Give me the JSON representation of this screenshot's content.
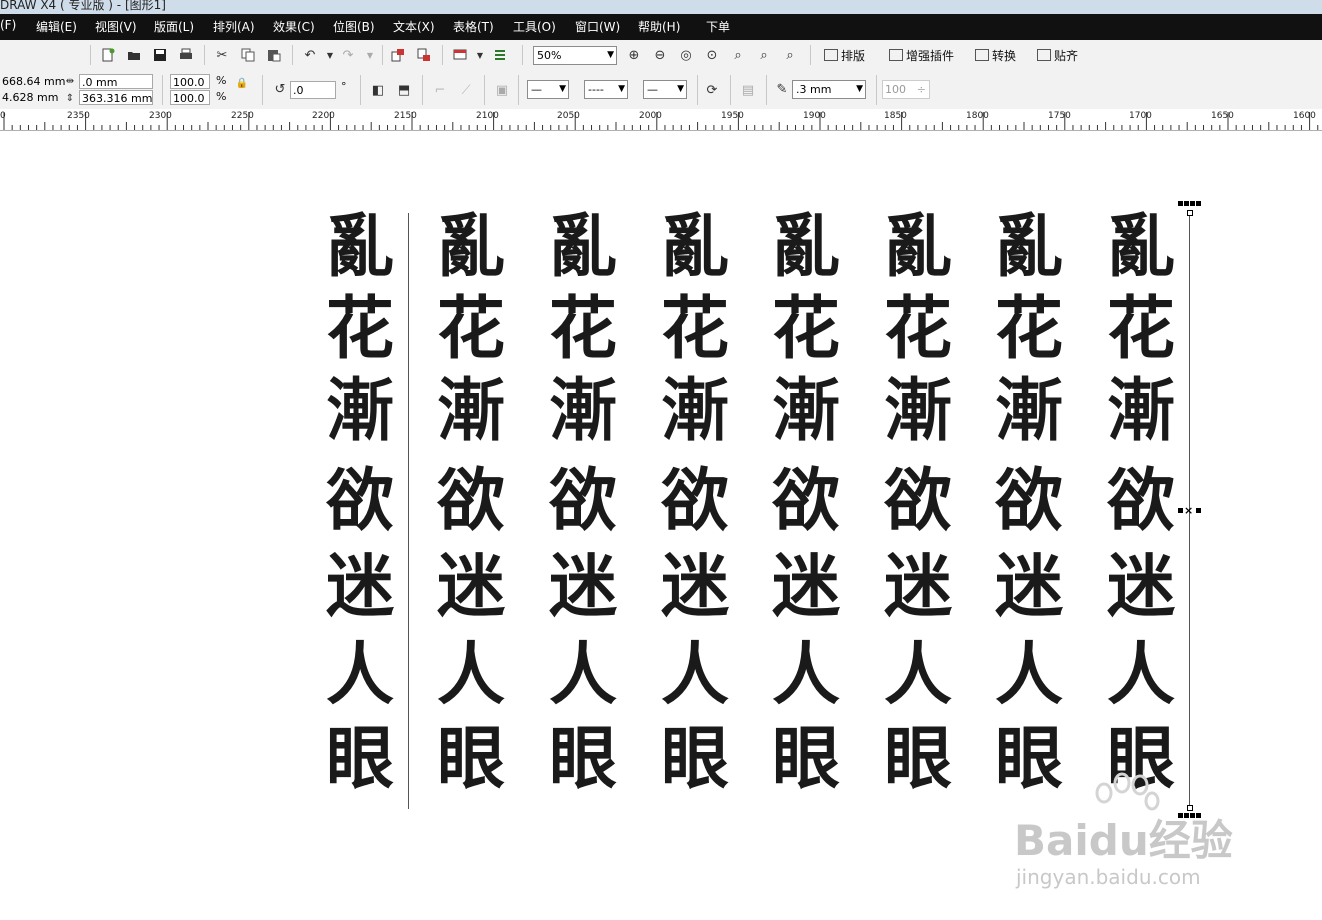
{
  "window": {
    "title": "DRAW X4 ( 专业版 ) - [图形1]"
  },
  "menu": [
    "(F)",
    "编辑(E)",
    "视图(V)",
    "版面(L)",
    "排列(A)",
    "效果(C)",
    "位图(B)",
    "文本(X)",
    "表格(T)",
    "工具(O)",
    "窗口(W)",
    "帮助(H)",
    "下单"
  ],
  "toolbar": {
    "zoom_value": "50%",
    "plugins": [
      "排版",
      "增强插件",
      "转换",
      "贴齐"
    ]
  },
  "property_bar": {
    "pos_x": "668.64 mm",
    "pos_y": "4.628 mm",
    "width": ".0 mm",
    "height": "363.316 mm",
    "scale_x": "100.0",
    "scale_y": "100.0",
    "pct": "%",
    "rotation": ".0",
    "degree": "°",
    "line_width": ".3 mm",
    "transparency": "100"
  },
  "ruler": {
    "labels": [
      "0",
      "2350",
      "2300",
      "2250",
      "2200",
      "2150",
      "2100",
      "2050",
      "2000",
      "1950",
      "1900",
      "1850",
      "1800",
      "1750",
      "1700",
      "1650",
      "1600"
    ]
  },
  "document": {
    "characters": [
      "亂",
      "花",
      "漸",
      "欲",
      "迷",
      "人",
      "眼"
    ],
    "column_count": 8
  },
  "watermark": {
    "text": "Baidu经验",
    "url": "jingyan.baidu.com"
  },
  "colors": {
    "menubar": "#111111",
    "toolbar": "#f2f2f2",
    "glyph": "#1a1a1a"
  }
}
